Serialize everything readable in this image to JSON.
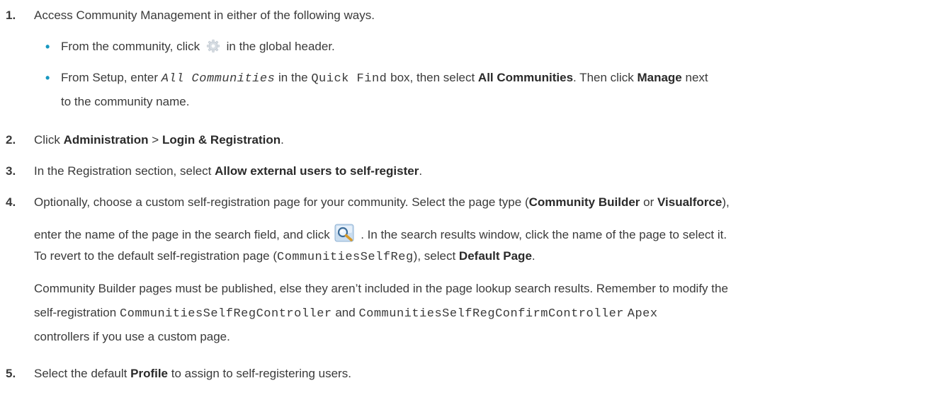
{
  "steps": [
    {
      "number": "1.",
      "text": "Access Community Management in either of the following ways.",
      "bullets": [
        {
          "pre": "From the community, click",
          "icon": "gear-icon",
          "post": "in the global header."
        },
        {
          "a": "From Setup, enter",
          "code1": "All Communities",
          "b": "in the",
          "code2": "Quick Find",
          "c": "box, then select",
          "bold1": "All Communities",
          "d": ". Then click",
          "bold2": "Manage",
          "e": "next",
          "line2": "to the community name."
        }
      ]
    },
    {
      "number": "2.",
      "a": "Click",
      "bold1": "Administration",
      "sep": ">",
      "bold2": "Login & Registration",
      "end": "."
    },
    {
      "number": "3.",
      "a": "In the Registration section, select",
      "bold1": "Allow external users to self-register",
      "end": "."
    },
    {
      "number": "4.",
      "line1_a": "Optionally, choose a custom self-registration page for your community. Select the page type (",
      "line1_bold1": "Community Builder",
      "line1_b": "or",
      "line1_bold2": "Visualforce",
      "line1_c": "),",
      "line2_a": "enter the name of the page in the search field, and click",
      "line2_icon": "lookup-icon",
      "line2_b": ". In the search results window, click the name of the page to select it.",
      "line3_a": "To revert to the default self-registration page (",
      "line3_code": "CommunitiesSelfReg",
      "line3_b": "), select",
      "line3_bold": "Default Page",
      "line3_c": ".",
      "para2_line1": "Community Builder pages must be published, else they aren’t included in the page lookup search results. Remember to modify the",
      "para2_line2_a": "self-registration",
      "para2_line2_code1": "CommunitiesSelfRegController",
      "para2_line2_b": "and",
      "para2_line2_code2": "CommunitiesSelfRegConfirmController",
      "para2_line2_c": "Apex",
      "para2_line3": "controllers if you use a custom page."
    },
    {
      "number": "5.",
      "a": "Select the default",
      "bold1": "Profile",
      "end": "to assign to self-registering users."
    }
  ],
  "colors": {
    "text": "#3a3a3a",
    "bullet": "#1797c0"
  }
}
